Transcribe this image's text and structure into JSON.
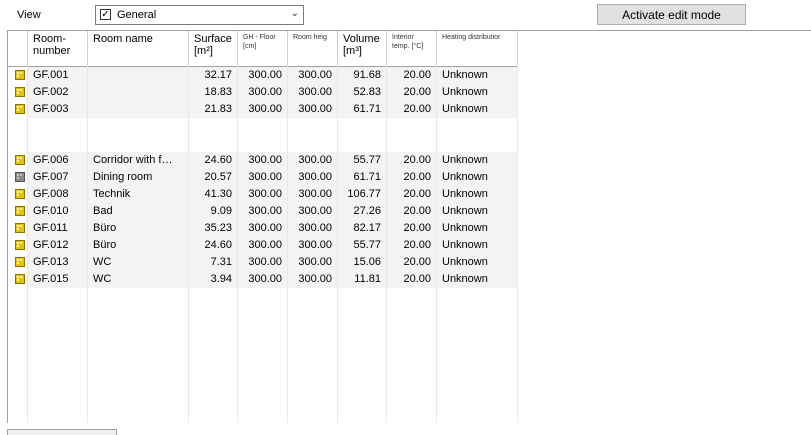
{
  "view": {
    "label": "View",
    "selected": "General",
    "checkbox_checked": true
  },
  "actions": {
    "edit_mode_label": "Activate edit mode"
  },
  "table": {
    "columns": [
      {
        "key": "icon",
        "label": ""
      },
      {
        "key": "room_number",
        "label": "Room-\nnumber"
      },
      {
        "key": "room_name",
        "label": "Room name"
      },
      {
        "key": "surface",
        "label": "Surface\n[m²]"
      },
      {
        "key": "gh_floor",
        "label": "GH - Floor [cm]"
      },
      {
        "key": "room_height",
        "label": "Room heig"
      },
      {
        "key": "volume",
        "label": "Volume\n[m³]"
      },
      {
        "key": "interior_temp",
        "label": "Interior temp. [°C]"
      },
      {
        "key": "heating_distribution",
        "label": "Heating distributior"
      }
    ],
    "rows": [
      {
        "icon": "room-yellow-icon",
        "room_number": "GF.001",
        "room_name": "",
        "surface": "32.17",
        "gh_floor": "300.00",
        "room_height": "300.00",
        "volume": "91.68",
        "interior_temp": "20.00",
        "heating_distribution": "Unknown"
      },
      {
        "icon": "room-yellow-icon",
        "room_number": "GF.002",
        "room_name": "",
        "surface": "18.83",
        "gh_floor": "300.00",
        "room_height": "300.00",
        "volume": "52.83",
        "interior_temp": "20.00",
        "heating_distribution": "Unknown"
      },
      {
        "icon": "room-yellow-icon",
        "room_number": "GF.003",
        "room_name": "",
        "surface": "21.83",
        "gh_floor": "300.00",
        "room_height": "300.00",
        "volume": "61.71",
        "interior_temp": "20.00",
        "heating_distribution": "Unknown"
      },
      {
        "icon": "room-yellow-icon",
        "room_number": "GF.006",
        "room_name": "Corridor with f…",
        "surface": "24.60",
        "gh_floor": "300.00",
        "room_height": "300.00",
        "volume": "55.77",
        "interior_temp": "20.00",
        "heating_distribution": "Unknown"
      },
      {
        "icon": "room-grey-icon",
        "room_number": "GF.007",
        "room_name": "Dining room",
        "surface": "20.57",
        "gh_floor": "300.00",
        "room_height": "300.00",
        "volume": "61.71",
        "interior_temp": "20.00",
        "heating_distribution": "Unknown"
      },
      {
        "icon": "room-yellow-icon",
        "room_number": "GF.008",
        "room_name": "Technik",
        "surface": "41.30",
        "gh_floor": "300.00",
        "room_height": "300.00",
        "volume": "106.77",
        "interior_temp": "20.00",
        "heating_distribution": "Unknown"
      },
      {
        "icon": "room-yellow-icon",
        "room_number": "GF.010",
        "room_name": "Bad",
        "surface": "9.09",
        "gh_floor": "300.00",
        "room_height": "300.00",
        "volume": "27.26",
        "interior_temp": "20.00",
        "heating_distribution": "Unknown"
      },
      {
        "icon": "room-yellow-icon",
        "room_number": "GF.011",
        "room_name": "Büro",
        "surface": "35.23",
        "gh_floor": "300.00",
        "room_height": "300.00",
        "volume": "82.17",
        "interior_temp": "20.00",
        "heating_distribution": "Unknown"
      },
      {
        "icon": "room-yellow-icon",
        "room_number": "GF.012",
        "room_name": "Büro",
        "surface": "24.60",
        "gh_floor": "300.00",
        "room_height": "300.00",
        "volume": "55.77",
        "interior_temp": "20.00",
        "heating_distribution": "Unknown"
      },
      {
        "icon": "room-yellow-icon",
        "room_number": "GF.013",
        "room_name": "WC",
        "surface": "7.31",
        "gh_floor": "300.00",
        "room_height": "300.00",
        "volume": "15.06",
        "interior_temp": "20.00",
        "heating_distribution": "Unknown"
      },
      {
        "icon": "room-yellow-icon",
        "room_number": "GF.015",
        "room_name": "WC",
        "surface": "3.94",
        "gh_floor": "300.00",
        "room_height": "300.00",
        "volume": "11.81",
        "interior_temp": "20.00",
        "heating_distribution": "Unknown"
      }
    ]
  }
}
